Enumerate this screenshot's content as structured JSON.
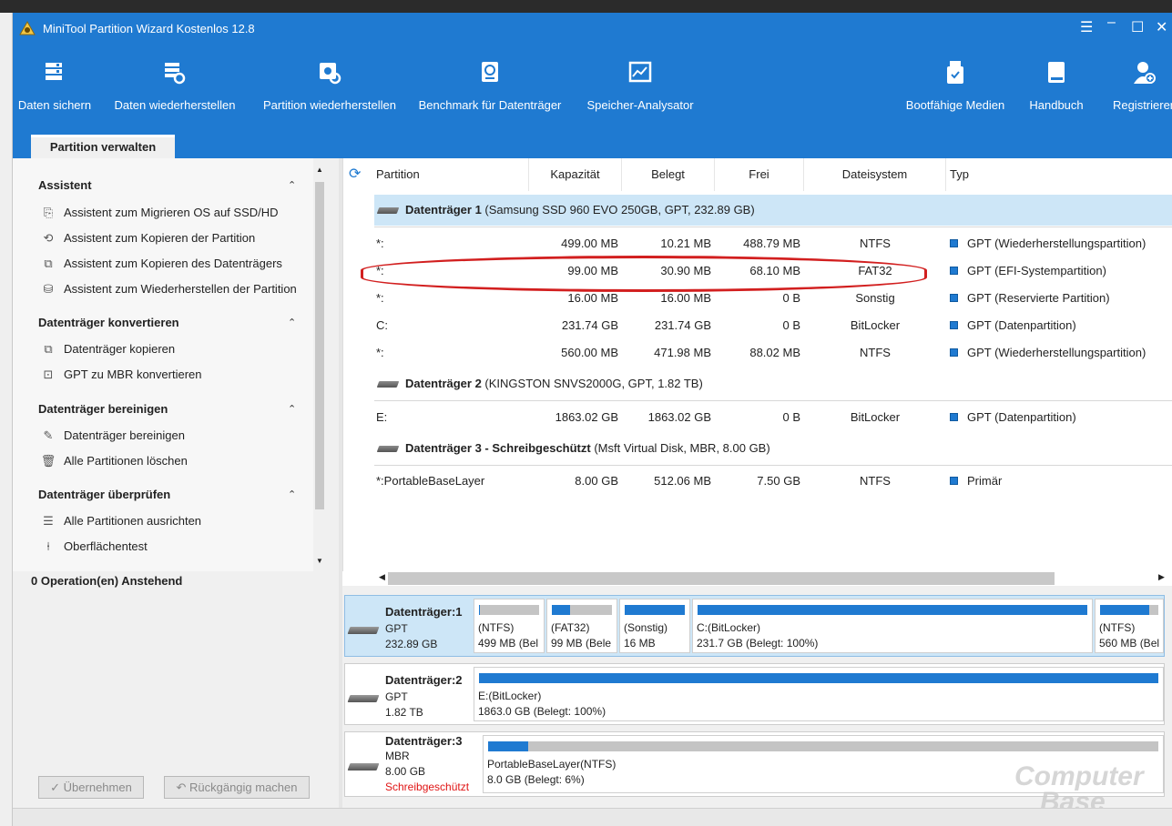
{
  "window": {
    "title": "MiniTool Partition Wizard Kostenlos 12.8"
  },
  "toolbar": {
    "items": [
      {
        "label": "Daten sichern",
        "icon": "backup-icon"
      },
      {
        "label": "Daten wiederherstellen",
        "icon": "data-recovery-icon"
      },
      {
        "label": "Partition wiederherstellen",
        "icon": "partition-recovery-icon"
      },
      {
        "label": "Benchmark für Datenträger",
        "icon": "disk-benchmark-icon"
      },
      {
        "label": "Speicher-Analysator",
        "icon": "space-analyzer-icon"
      },
      {
        "label": "Bootfähige Medien",
        "icon": "bootable-media-icon"
      },
      {
        "label": "Handbuch",
        "icon": "manual-icon"
      },
      {
        "label": "Registrieren",
        "icon": "register-icon"
      }
    ]
  },
  "tab": {
    "label": "Partition verwalten"
  },
  "sidebar": {
    "sections": [
      {
        "title": "Assistent",
        "items": [
          {
            "label": "Assistent zum Migrieren OS auf SSD/HD"
          },
          {
            "label": "Assistent zum Kopieren der Partition"
          },
          {
            "label": "Assistent zum Kopieren des Datenträgers"
          },
          {
            "label": "Assistent zum Wiederherstellen der Partition"
          }
        ]
      },
      {
        "title": "Datenträger konvertieren",
        "items": [
          {
            "label": "Datenträger kopieren"
          },
          {
            "label": "GPT zu MBR konvertieren"
          }
        ]
      },
      {
        "title": "Datenträger bereinigen",
        "items": [
          {
            "label": "Datenträger bereinigen"
          },
          {
            "label": "Alle Partitionen löschen"
          }
        ]
      },
      {
        "title": "Datenträger überprüfen",
        "items": [
          {
            "label": "Alle Partitionen ausrichten"
          },
          {
            "label": "Oberflächentest"
          }
        ]
      }
    ],
    "pending": "0 Operation(en) Anstehend",
    "apply": "Übernehmen",
    "undo": "Rückgängig machen"
  },
  "table": {
    "headers": [
      "Partition",
      "Kapazität",
      "Belegt",
      "Frei",
      "Dateisystem",
      "Typ"
    ],
    "disks": [
      {
        "name": "Datenträger 1",
        "detail": " (Samsung SSD 960 EVO 250GB, GPT, 232.89 GB)",
        "partitions": [
          [
            "*:",
            "499.00 MB",
            "10.21 MB",
            "488.79 MB",
            "NTFS",
            "GPT (Wiederherstellungspartition)"
          ],
          [
            "*:",
            "99.00 MB",
            "30.90 MB",
            "68.10 MB",
            "FAT32",
            "GPT (EFI-Systempartition)"
          ],
          [
            "*:",
            "16.00 MB",
            "16.00 MB",
            "0 B",
            "Sonstig",
            "GPT (Reservierte Partition)"
          ],
          [
            "C:",
            "231.74 GB",
            "231.74 GB",
            "0 B",
            "BitLocker",
            "GPT (Datenpartition)"
          ],
          [
            "*:",
            "560.00 MB",
            "471.98 MB",
            "88.02 MB",
            "NTFS",
            "GPT (Wiederherstellungspartition)"
          ]
        ]
      },
      {
        "name": "Datenträger 2",
        "detail": " (KINGSTON SNVS2000G, GPT, 1.82 TB)",
        "partitions": [
          [
            "E:",
            "1863.02 GB",
            "1863.02 GB",
            "0 B",
            "BitLocker",
            "GPT (Datenpartition)"
          ]
        ]
      },
      {
        "name": "Datenträger 3 - Schreibgeschützt",
        "detail": " (Msft Virtual Disk, MBR, 8.00 GB)",
        "partitions": [
          [
            "*:PortableBaseLayer",
            "8.00 GB",
            "512.06 MB",
            "7.50 GB",
            "NTFS",
            "Primär"
          ]
        ]
      }
    ]
  },
  "diskmap": {
    "disks": [
      {
        "name": "Datenträger:1",
        "style": "GPT",
        "size": "232.89 GB",
        "note": "",
        "partitions": [
          {
            "l1": "(NTFS)",
            "l2": "499 MB (Bel",
            "used": 0.02
          },
          {
            "l1": "(FAT32)",
            "l2": "99 MB (Bele",
            "used": 0.31
          },
          {
            "l1": "(Sonstig)",
            "l2": "16 MB",
            "used": 1.0
          },
          {
            "l1": "C:(BitLocker)",
            "l2": "231.7 GB (Belegt: 100%)",
            "used": 1.0
          },
          {
            "l1": "(NTFS)",
            "l2": "560 MB (Bel",
            "used": 0.84
          }
        ]
      },
      {
        "name": "Datenträger:2",
        "style": "GPT",
        "size": "1.82 TB",
        "note": "",
        "partitions": [
          {
            "l1": "E:(BitLocker)",
            "l2": "1863.0 GB (Belegt: 100%)",
            "used": 1.0
          }
        ]
      },
      {
        "name": "Datenträger:3",
        "style": "MBR",
        "size": "8.00 GB",
        "note": "Schreibgeschützt",
        "partitions": [
          {
            "l1": "PortableBaseLayer(NTFS)",
            "l2": "8.0 GB (Belegt: 6%)",
            "used": 0.06
          }
        ]
      }
    ]
  },
  "colors": {
    "accent": "#1f7ad1",
    "selection": "#cde6f7",
    "highlight_ring": "#d21f1f",
    "readonly": "#e01414"
  },
  "watermark": {
    "line1": "Computer",
    "line2": "Base"
  }
}
